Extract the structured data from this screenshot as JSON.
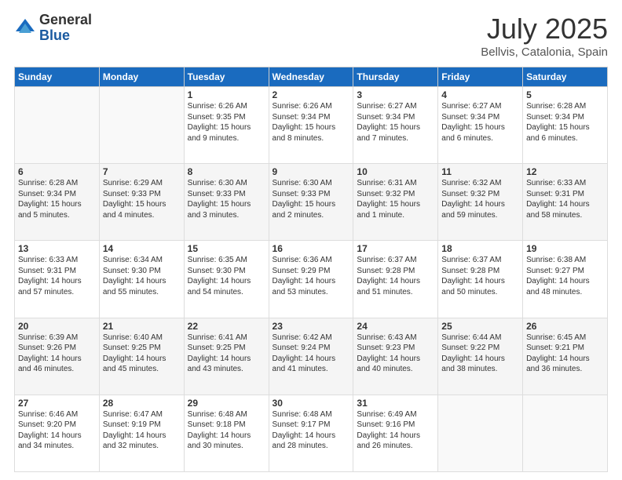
{
  "logo": {
    "general": "General",
    "blue": "Blue"
  },
  "header": {
    "month": "July 2025",
    "location": "Bellvis, Catalonia, Spain"
  },
  "weekdays": [
    "Sunday",
    "Monday",
    "Tuesday",
    "Wednesday",
    "Thursday",
    "Friday",
    "Saturday"
  ],
  "weeks": [
    [
      {
        "day": "",
        "info": ""
      },
      {
        "day": "",
        "info": ""
      },
      {
        "day": "1",
        "info": "Sunrise: 6:26 AM\nSunset: 9:35 PM\nDaylight: 15 hours\nand 9 minutes."
      },
      {
        "day": "2",
        "info": "Sunrise: 6:26 AM\nSunset: 9:34 PM\nDaylight: 15 hours\nand 8 minutes."
      },
      {
        "day": "3",
        "info": "Sunrise: 6:27 AM\nSunset: 9:34 PM\nDaylight: 15 hours\nand 7 minutes."
      },
      {
        "day": "4",
        "info": "Sunrise: 6:27 AM\nSunset: 9:34 PM\nDaylight: 15 hours\nand 6 minutes."
      },
      {
        "day": "5",
        "info": "Sunrise: 6:28 AM\nSunset: 9:34 PM\nDaylight: 15 hours\nand 6 minutes."
      }
    ],
    [
      {
        "day": "6",
        "info": "Sunrise: 6:28 AM\nSunset: 9:34 PM\nDaylight: 15 hours\nand 5 minutes."
      },
      {
        "day": "7",
        "info": "Sunrise: 6:29 AM\nSunset: 9:33 PM\nDaylight: 15 hours\nand 4 minutes."
      },
      {
        "day": "8",
        "info": "Sunrise: 6:30 AM\nSunset: 9:33 PM\nDaylight: 15 hours\nand 3 minutes."
      },
      {
        "day": "9",
        "info": "Sunrise: 6:30 AM\nSunset: 9:33 PM\nDaylight: 15 hours\nand 2 minutes."
      },
      {
        "day": "10",
        "info": "Sunrise: 6:31 AM\nSunset: 9:32 PM\nDaylight: 15 hours\nand 1 minute."
      },
      {
        "day": "11",
        "info": "Sunrise: 6:32 AM\nSunset: 9:32 PM\nDaylight: 14 hours\nand 59 minutes."
      },
      {
        "day": "12",
        "info": "Sunrise: 6:33 AM\nSunset: 9:31 PM\nDaylight: 14 hours\nand 58 minutes."
      }
    ],
    [
      {
        "day": "13",
        "info": "Sunrise: 6:33 AM\nSunset: 9:31 PM\nDaylight: 14 hours\nand 57 minutes."
      },
      {
        "day": "14",
        "info": "Sunrise: 6:34 AM\nSunset: 9:30 PM\nDaylight: 14 hours\nand 55 minutes."
      },
      {
        "day": "15",
        "info": "Sunrise: 6:35 AM\nSunset: 9:30 PM\nDaylight: 14 hours\nand 54 minutes."
      },
      {
        "day": "16",
        "info": "Sunrise: 6:36 AM\nSunset: 9:29 PM\nDaylight: 14 hours\nand 53 minutes."
      },
      {
        "day": "17",
        "info": "Sunrise: 6:37 AM\nSunset: 9:28 PM\nDaylight: 14 hours\nand 51 minutes."
      },
      {
        "day": "18",
        "info": "Sunrise: 6:37 AM\nSunset: 9:28 PM\nDaylight: 14 hours\nand 50 minutes."
      },
      {
        "day": "19",
        "info": "Sunrise: 6:38 AM\nSunset: 9:27 PM\nDaylight: 14 hours\nand 48 minutes."
      }
    ],
    [
      {
        "day": "20",
        "info": "Sunrise: 6:39 AM\nSunset: 9:26 PM\nDaylight: 14 hours\nand 46 minutes."
      },
      {
        "day": "21",
        "info": "Sunrise: 6:40 AM\nSunset: 9:25 PM\nDaylight: 14 hours\nand 45 minutes."
      },
      {
        "day": "22",
        "info": "Sunrise: 6:41 AM\nSunset: 9:25 PM\nDaylight: 14 hours\nand 43 minutes."
      },
      {
        "day": "23",
        "info": "Sunrise: 6:42 AM\nSunset: 9:24 PM\nDaylight: 14 hours\nand 41 minutes."
      },
      {
        "day": "24",
        "info": "Sunrise: 6:43 AM\nSunset: 9:23 PM\nDaylight: 14 hours\nand 40 minutes."
      },
      {
        "day": "25",
        "info": "Sunrise: 6:44 AM\nSunset: 9:22 PM\nDaylight: 14 hours\nand 38 minutes."
      },
      {
        "day": "26",
        "info": "Sunrise: 6:45 AM\nSunset: 9:21 PM\nDaylight: 14 hours\nand 36 minutes."
      }
    ],
    [
      {
        "day": "27",
        "info": "Sunrise: 6:46 AM\nSunset: 9:20 PM\nDaylight: 14 hours\nand 34 minutes."
      },
      {
        "day": "28",
        "info": "Sunrise: 6:47 AM\nSunset: 9:19 PM\nDaylight: 14 hours\nand 32 minutes."
      },
      {
        "day": "29",
        "info": "Sunrise: 6:48 AM\nSunset: 9:18 PM\nDaylight: 14 hours\nand 30 minutes."
      },
      {
        "day": "30",
        "info": "Sunrise: 6:48 AM\nSunset: 9:17 PM\nDaylight: 14 hours\nand 28 minutes."
      },
      {
        "day": "31",
        "info": "Sunrise: 6:49 AM\nSunset: 9:16 PM\nDaylight: 14 hours\nand 26 minutes."
      },
      {
        "day": "",
        "info": ""
      },
      {
        "day": "",
        "info": ""
      }
    ]
  ]
}
